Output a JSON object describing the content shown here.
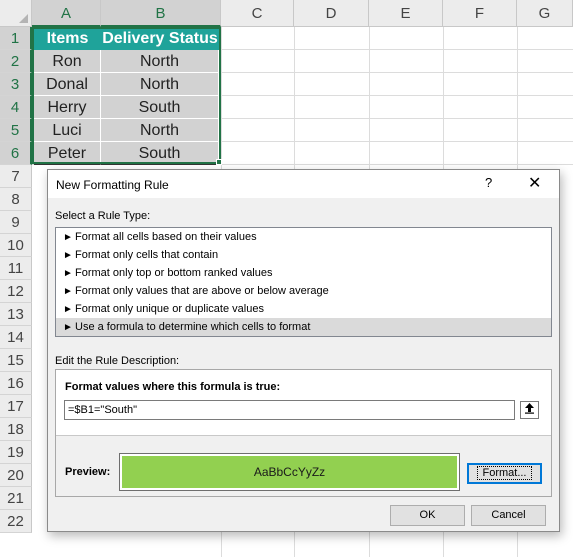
{
  "sheet": {
    "columns": [
      "A",
      "B",
      "C",
      "D",
      "E",
      "F",
      "G"
    ],
    "rows": [
      "1",
      "2",
      "3",
      "4",
      "5",
      "6",
      "7",
      "8",
      "9",
      "10",
      "11",
      "12",
      "13",
      "14",
      "15",
      "16",
      "17",
      "18",
      "19",
      "20",
      "21",
      "22"
    ],
    "table": {
      "headers": [
        "Items",
        "Delivery Status"
      ],
      "data": [
        [
          "Ron",
          "North"
        ],
        [
          "Donal",
          "North"
        ],
        [
          "Herry",
          "South"
        ],
        [
          "Luci",
          "North"
        ],
        [
          "Peter",
          "South"
        ]
      ]
    },
    "header_color": "#1fa39a",
    "selection_color": "#217346"
  },
  "dialog": {
    "title": "New Formatting Rule",
    "help_label": "?",
    "close_label": "✕",
    "rule_type_label": "Select a Rule Type:",
    "rule_types": [
      "Format all cells based on their values",
      "Format only cells that contain",
      "Format only top or bottom ranked values",
      "Format only values that are above or below average",
      "Format only unique or duplicate values",
      "Use a formula to determine which cells to format"
    ],
    "selected_rule_index": 5,
    "description_label": "Edit the Rule Description:",
    "formula_label": "Format values where this formula is true:",
    "formula_value": "=$B1=\"South\"",
    "collapse_icon": "upload-arrow",
    "preview_label": "Preview:",
    "preview_text": "AaBbCcYyZz",
    "preview_color": "#92d050",
    "format_button": "Format...",
    "ok_button": "OK",
    "cancel_button": "Cancel"
  }
}
